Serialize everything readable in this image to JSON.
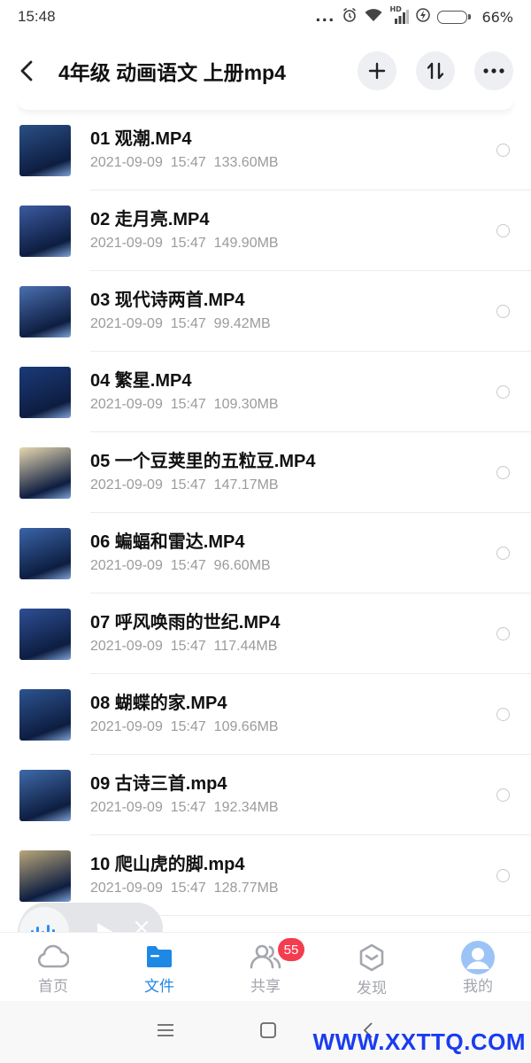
{
  "status_bar": {
    "time": "15:48",
    "dots": "...",
    "signal_label": "HD",
    "battery_percent": "66%",
    "battery_level": 0.66
  },
  "header": {
    "title": "4年级 动画语文 上册mp4"
  },
  "files": [
    {
      "name": "01 观潮.MP4",
      "meta": "2021-09-09  15:47  133.60MB",
      "thumb_color": "#2a4f86"
    },
    {
      "name": "02 走月亮.MP4",
      "meta": "2021-09-09  15:47  149.90MB",
      "thumb_color": "#3b5aa0"
    },
    {
      "name": "03 现代诗两首.MP4",
      "meta": "2021-09-09  15:47  99.42MB",
      "thumb_color": "#4a6fb0"
    },
    {
      "name": "04 繁星.MP4",
      "meta": "2021-09-09  15:47  109.30MB",
      "thumb_color": "#1b3a7a"
    },
    {
      "name": "05 一个豆荚里的五粒豆.MP4",
      "meta": "2021-09-09  15:47  147.17MB",
      "thumb_color": "#e7d8b0"
    },
    {
      "name": "06 蝙蝠和雷达.MP4",
      "meta": "2021-09-09  15:47  96.60MB",
      "thumb_color": "#3a64a8"
    },
    {
      "name": "07 呼风唤雨的世纪.MP4",
      "meta": "2021-09-09  15:47  117.44MB",
      "thumb_color": "#2e4f95"
    },
    {
      "name": "08 蝴蝶的家.MP4",
      "meta": "2021-09-09  15:47  109.66MB",
      "thumb_color": "#2c5390"
    },
    {
      "name": "09 古诗三首.mp4",
      "meta": "2021-09-09  15:47  192.34MB",
      "thumb_color": "#3f6aa8"
    },
    {
      "name": "10 爬山虎的脚.mp4",
      "meta": "2021-09-09  15:47  128.77MB",
      "thumb_color": "#b9a67a"
    }
  ],
  "bottom_nav": {
    "items": [
      {
        "label": "首页"
      },
      {
        "label": "文件"
      },
      {
        "label": "共享",
        "badge": "55"
      },
      {
        "label": "发现"
      },
      {
        "label": "我的"
      }
    ]
  },
  "watermark": "WWW.XXTTQ.COM",
  "colors": {
    "accent": "#1e88e5",
    "badge": "#f43c4f",
    "watermark": "#1a3cf0"
  }
}
